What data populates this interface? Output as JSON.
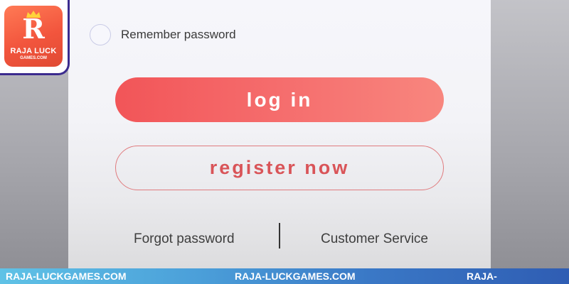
{
  "logo": {
    "letter": "R",
    "name": "RAJA LUCK",
    "subtitle": "GAMES.COM"
  },
  "form": {
    "remember_label": "Remember password",
    "remember_checked": false,
    "login_label": "log in",
    "register_label": "register now"
  },
  "footer": {
    "forgot_label": "Forgot password",
    "service_label": "Customer Service"
  },
  "watermark": {
    "items": [
      "RAJA-LUCKGAMES.COM",
      "RAJA-LUCKGAMES.COM",
      "RAJA-LUCKGAMES.COM"
    ]
  },
  "colors": {
    "accent": "#f25558",
    "register_text": "#d95458",
    "logo_bg": "#f2553d",
    "logo_border": "#3b2b8e"
  },
  "icons": {
    "remember": "radio-circle-icon",
    "crown": "crown-icon"
  }
}
